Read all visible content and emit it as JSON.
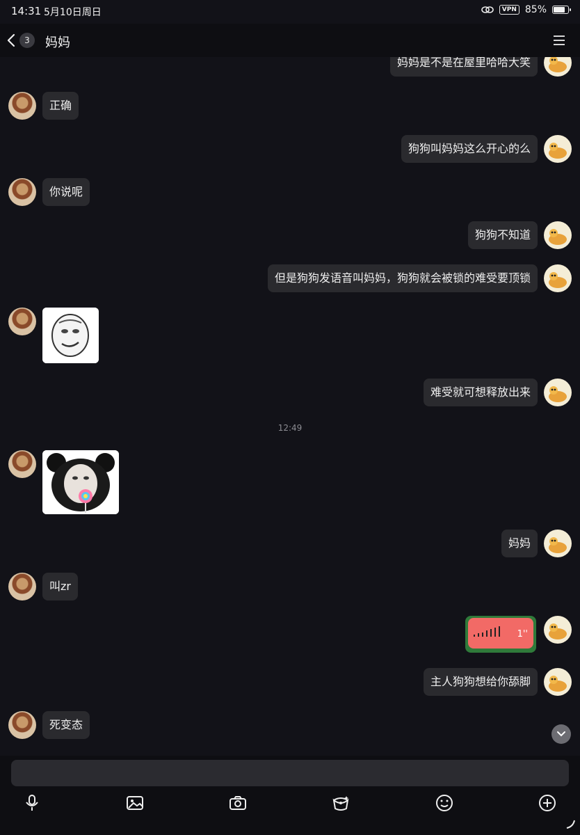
{
  "status_bar": {
    "time": "14:31",
    "date": "5月10日周日",
    "vpn": "VPN",
    "battery": "85%",
    "battery_level": 0.85
  },
  "nav": {
    "unread_count": "3",
    "title": "妈妈",
    "back_icon": "chevron-left-icon",
    "menu_icon": "menu-icon"
  },
  "messages": [
    {
      "side": "right",
      "type": "text",
      "text": "妈妈是不是在屋里哈哈大笑"
    },
    {
      "side": "left",
      "type": "text",
      "text": "正确"
    },
    {
      "side": "right",
      "type": "text",
      "text": "狗狗叫妈妈这么开心的么"
    },
    {
      "side": "left",
      "type": "text",
      "text": "你说呢"
    },
    {
      "side": "right",
      "type": "text",
      "text": "狗狗不知道"
    },
    {
      "side": "right",
      "type": "text",
      "text": "但是狗狗发语音叫妈妈，狗狗就会被锁的难受要顶锁"
    },
    {
      "side": "left",
      "type": "sticker",
      "sticker": "meme-face-sticker"
    },
    {
      "side": "right",
      "type": "text",
      "text": "难受就可想释放出来"
    },
    {
      "type": "timestamp",
      "text": "12:49"
    },
    {
      "side": "left",
      "type": "sticker",
      "sticker": "panda-lollipop-sticker"
    },
    {
      "side": "right",
      "type": "text",
      "text": "妈妈"
    },
    {
      "side": "left",
      "type": "text",
      "text": "叫zr"
    },
    {
      "side": "right",
      "type": "voice",
      "duration": "1''"
    },
    {
      "side": "right",
      "type": "text",
      "text": "主人狗狗想给你舔脚"
    },
    {
      "side": "left",
      "type": "text",
      "text": "死变态"
    }
  ],
  "input": {
    "placeholder": ""
  },
  "toolbar": [
    "microphone-icon",
    "image-icon",
    "camera-icon",
    "redpacket-icon",
    "emoji-icon",
    "plus-icon"
  ],
  "colors": {
    "background": "#121218",
    "bubble": "#2a2a2e",
    "voice_bubble": "#f0605c"
  }
}
